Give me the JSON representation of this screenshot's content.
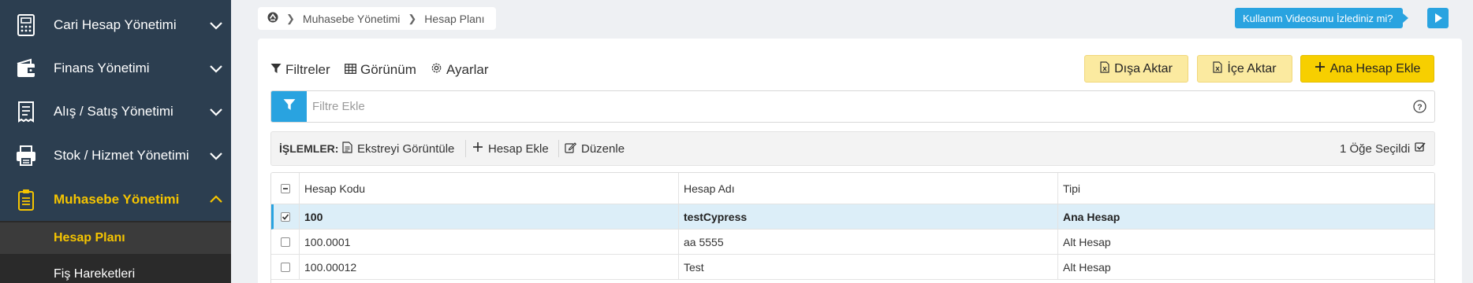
{
  "sidebar": {
    "items": [
      {
        "label": "Cari Hesap Yönetimi",
        "icon": "calculator-icon"
      },
      {
        "label": "Finans Yönetimi",
        "icon": "wallet-icon"
      },
      {
        "label": "Alış / Satış Yönetimi",
        "icon": "receipt-icon"
      },
      {
        "label": "Stok / Hizmet Yönetimi",
        "icon": "printer-icon"
      },
      {
        "label": "Muhasebe Yönetimi",
        "icon": "clipboard-icon"
      }
    ],
    "subitems": [
      {
        "label": "Hesap Planı"
      },
      {
        "label": "Fiş Hareketleri"
      }
    ],
    "accent_color": "#f5c400",
    "background_color": "#2c3e50"
  },
  "breadcrumb": {
    "items": [
      "Muhasebe Yönetimi",
      "Hesap Planı"
    ]
  },
  "video_cta": {
    "label": "Kullanım Videosunu İzlediniz mi?"
  },
  "toolbar": {
    "filters_label": "Filtreler",
    "view_label": "Görünüm",
    "settings_label": "Ayarlar",
    "export_label": "Dışa Aktar",
    "import_label": "İçe Aktar",
    "add_main_account_label": "Ana Hesap Ekle"
  },
  "filter": {
    "placeholder": "Filtre Ekle"
  },
  "actions": {
    "label": "İŞLEMLER:",
    "view_statement": "Ekstreyi Görüntüle",
    "add_account": "Hesap Ekle",
    "edit": "Düzenle",
    "selected_count": "1 Öğe Seçildi"
  },
  "table": {
    "columns": [
      "Hesap Kodu",
      "Hesap Adı",
      "Tipi"
    ],
    "rows": [
      {
        "code": "100",
        "name": "testCypress",
        "type": "Ana Hesap",
        "checked": true
      },
      {
        "code": "100.0001",
        "name": "aa 5555",
        "type": "Alt Hesap",
        "checked": false
      },
      {
        "code": "100.00012",
        "name": "Test",
        "type": "Alt Hesap",
        "checked": false
      }
    ]
  },
  "colors": {
    "primary_blue": "#29a3e0",
    "button_yellow": "#f7cf00",
    "button_light_yellow": "#fbeaa0",
    "selected_row": "#dceef8"
  }
}
